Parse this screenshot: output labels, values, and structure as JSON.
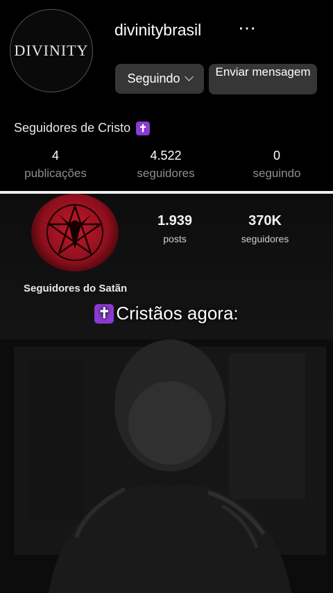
{
  "profile1": {
    "avatar_text": "DIVINITY",
    "username": "divinitybrasil",
    "more_icon": "⋯",
    "follow_button": "Seguindo",
    "message_button": "Enviar mensagem",
    "bio": "Seguidores de Cristo",
    "bio_emoji": "✝",
    "stats": [
      {
        "value": "4",
        "label": "publicações"
      },
      {
        "value": "4.522",
        "label": "seguidores"
      },
      {
        "value": "0",
        "label": "seguindo"
      }
    ]
  },
  "profile2": {
    "stats": [
      {
        "value": "1.939",
        "label": "posts"
      },
      {
        "value": "370K",
        "label": "seguidores"
      }
    ],
    "bio": "Seguidores do Satãn"
  },
  "meme": {
    "caption_emoji": "✝",
    "caption": "Cristãos agora:"
  }
}
